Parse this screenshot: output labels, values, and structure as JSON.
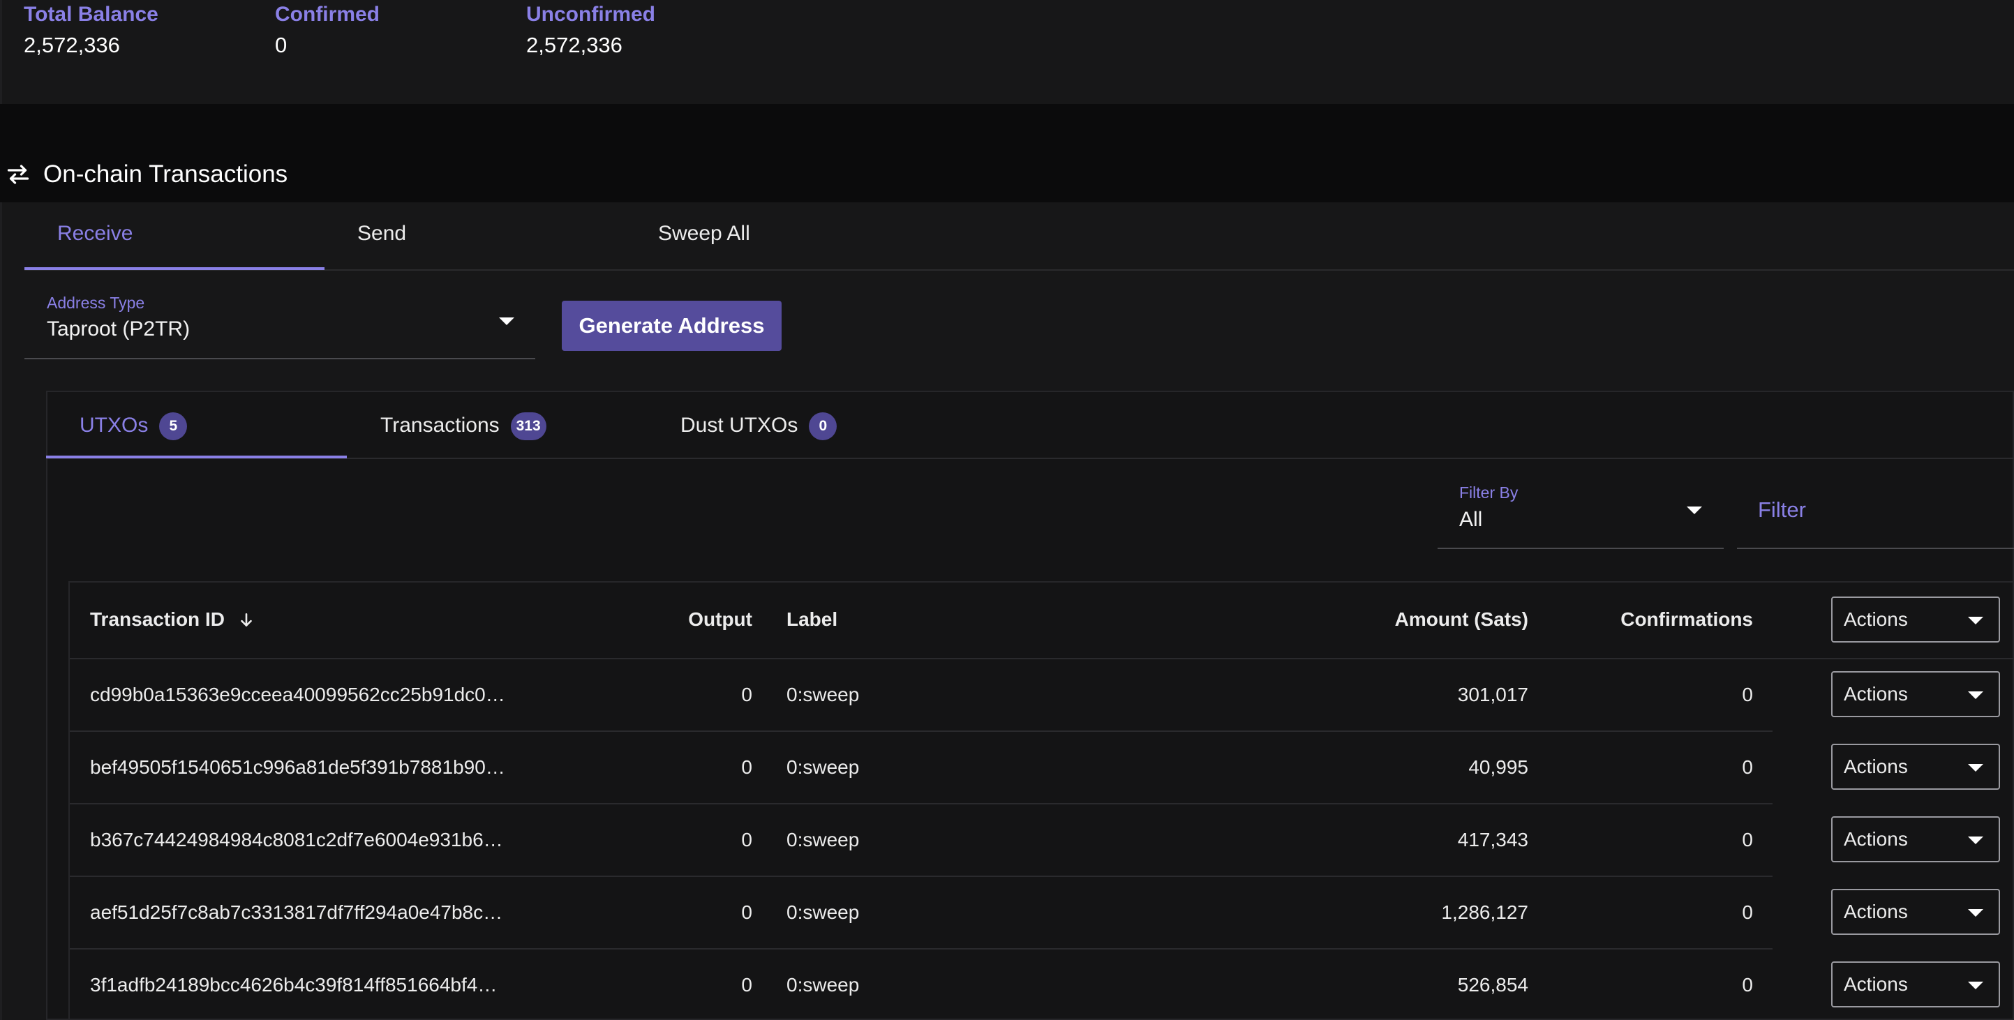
{
  "balances": [
    {
      "label": "Total Balance",
      "value": "2,572,336"
    },
    {
      "label": "Confirmed",
      "value": "0"
    },
    {
      "label": "Unconfirmed",
      "value": "2,572,336"
    }
  ],
  "section": {
    "title": "On-chain Transactions",
    "icon": "swap-arrows-icon"
  },
  "main_tabs": [
    {
      "label": "Receive",
      "active": true
    },
    {
      "label": "Send",
      "active": false
    },
    {
      "label": "Sweep All",
      "active": false
    }
  ],
  "address_type": {
    "label": "Address Type",
    "value": "Taproot (P2TR)"
  },
  "generate_button": "Generate Address",
  "utxo_tabs": [
    {
      "label": "UTXOs",
      "count": "5",
      "active": true
    },
    {
      "label": "Transactions",
      "count": "313",
      "active": false
    },
    {
      "label": "Dust UTXOs",
      "count": "0",
      "active": false
    }
  ],
  "filter_by": {
    "label": "Filter By",
    "value": "All"
  },
  "filter_input": {
    "placeholder": "Filter"
  },
  "table": {
    "columns": {
      "txid": "Transaction ID",
      "output": "Output",
      "label": "Label",
      "amount": "Amount (Sats)",
      "confirmations": "Confirmations",
      "actions": "Actions"
    },
    "rows": [
      {
        "txid": "cd99b0a15363e9cceea40099562cc25b91dc0…",
        "output": "0",
        "label": "0:sweep",
        "amount": "301,017",
        "confirmations": "0",
        "actions": "Actions"
      },
      {
        "txid": "bef49505f1540651c996a81de5f391b7881b90…",
        "output": "0",
        "label": "0:sweep",
        "amount": "40,995",
        "confirmations": "0",
        "actions": "Actions"
      },
      {
        "txid": "b367c74424984984c8081c2df7e6004e931b6…",
        "output": "0",
        "label": "0:sweep",
        "amount": "417,343",
        "confirmations": "0",
        "actions": "Actions"
      },
      {
        "txid": "aef51d25f7c8ab7c3313817df7ff294a0e47b8c…",
        "output": "0",
        "label": "0:sweep",
        "amount": "1,286,127",
        "confirmations": "0",
        "actions": "Actions"
      },
      {
        "txid": "3f1adfb24189bcc4626b4c39f814ff851664bf4…",
        "output": "0",
        "label": "0:sweep",
        "amount": "526,854",
        "confirmations": "0",
        "actions": "Actions"
      }
    ]
  },
  "colors": {
    "accent": "#8a80e6",
    "button": "#554c9c",
    "background": "#0b0b0c",
    "panel": "#171718"
  }
}
